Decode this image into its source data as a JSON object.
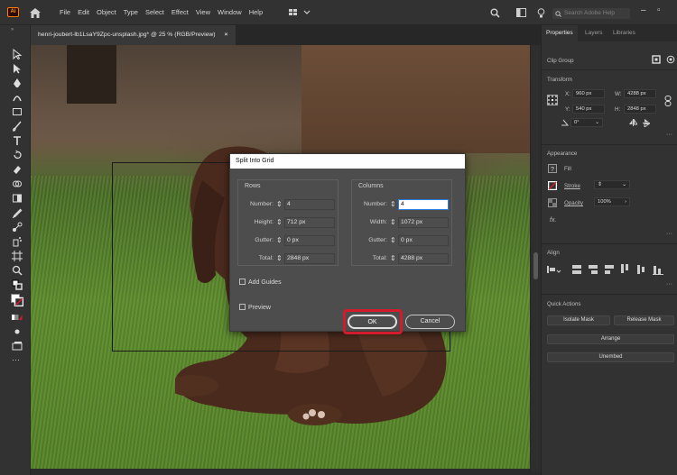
{
  "app": {
    "logo_text": "Ai"
  },
  "menu": [
    "File",
    "Edit",
    "Object",
    "Type",
    "Select",
    "Effect",
    "View",
    "Window",
    "Help"
  ],
  "search": {
    "placeholder": "Search Adobe Help"
  },
  "document_tab": {
    "title": "henri-joubert-lb1LsaY9Zpc-unsplash.jpg* @ 25 % (RGB/Preview)",
    "close": "×"
  },
  "panel": {
    "tabs": [
      "Properties",
      "Layers",
      "Libraries"
    ],
    "selection_type": "Clip Group",
    "transform": {
      "heading": "Transform",
      "x_label": "X:",
      "x_value": "960 px",
      "y_label": "Y:",
      "y_value": "540 px",
      "w_label": "W:",
      "w_value": "4288 px",
      "h_label": "H:",
      "h_value": "2848 px",
      "angle_value": "0°"
    },
    "appearance": {
      "heading": "Appearance",
      "fill_label": "Fill",
      "stroke_label": "Stroke",
      "opacity_label": "Opacity",
      "opacity_value": "100%",
      "fx_label": "fx."
    },
    "align": {
      "heading": "Align"
    },
    "quick_actions": {
      "heading": "Quick Actions",
      "isolate_mask": "Isolate Mask",
      "release_mask": "Release Mask",
      "arrange": "Arrange",
      "unembed": "Unembed"
    }
  },
  "dialog": {
    "title": "Split Into Grid",
    "rows": {
      "heading": "Rows",
      "number_label": "Number:",
      "number_value": "4",
      "height_label": "Height:",
      "height_value": "712 px",
      "gutter_label": "Gutter:",
      "gutter_value": "0 px",
      "total_label": "Total:",
      "total_value": "2848 px"
    },
    "columns": {
      "heading": "Columns",
      "number_label": "Number:",
      "number_value": "4",
      "width_label": "Width:",
      "width_value": "1072 px",
      "gutter_label": "Gutter:",
      "gutter_value": "0 px",
      "total_label": "Total:",
      "total_value": "4288 px"
    },
    "add_guides_label": "Add Guides",
    "preview_label": "Preview",
    "ok_label": "OK",
    "cancel_label": "Cancel"
  },
  "colors": {
    "highlight": "#d21c2b",
    "app_accent": "#ff7c00"
  },
  "icons": [
    "home-icon",
    "search-icon",
    "selection-tool-icon",
    "pen-tool-icon",
    "type-tool-icon",
    "chain-link-icon",
    "close-icon"
  ]
}
